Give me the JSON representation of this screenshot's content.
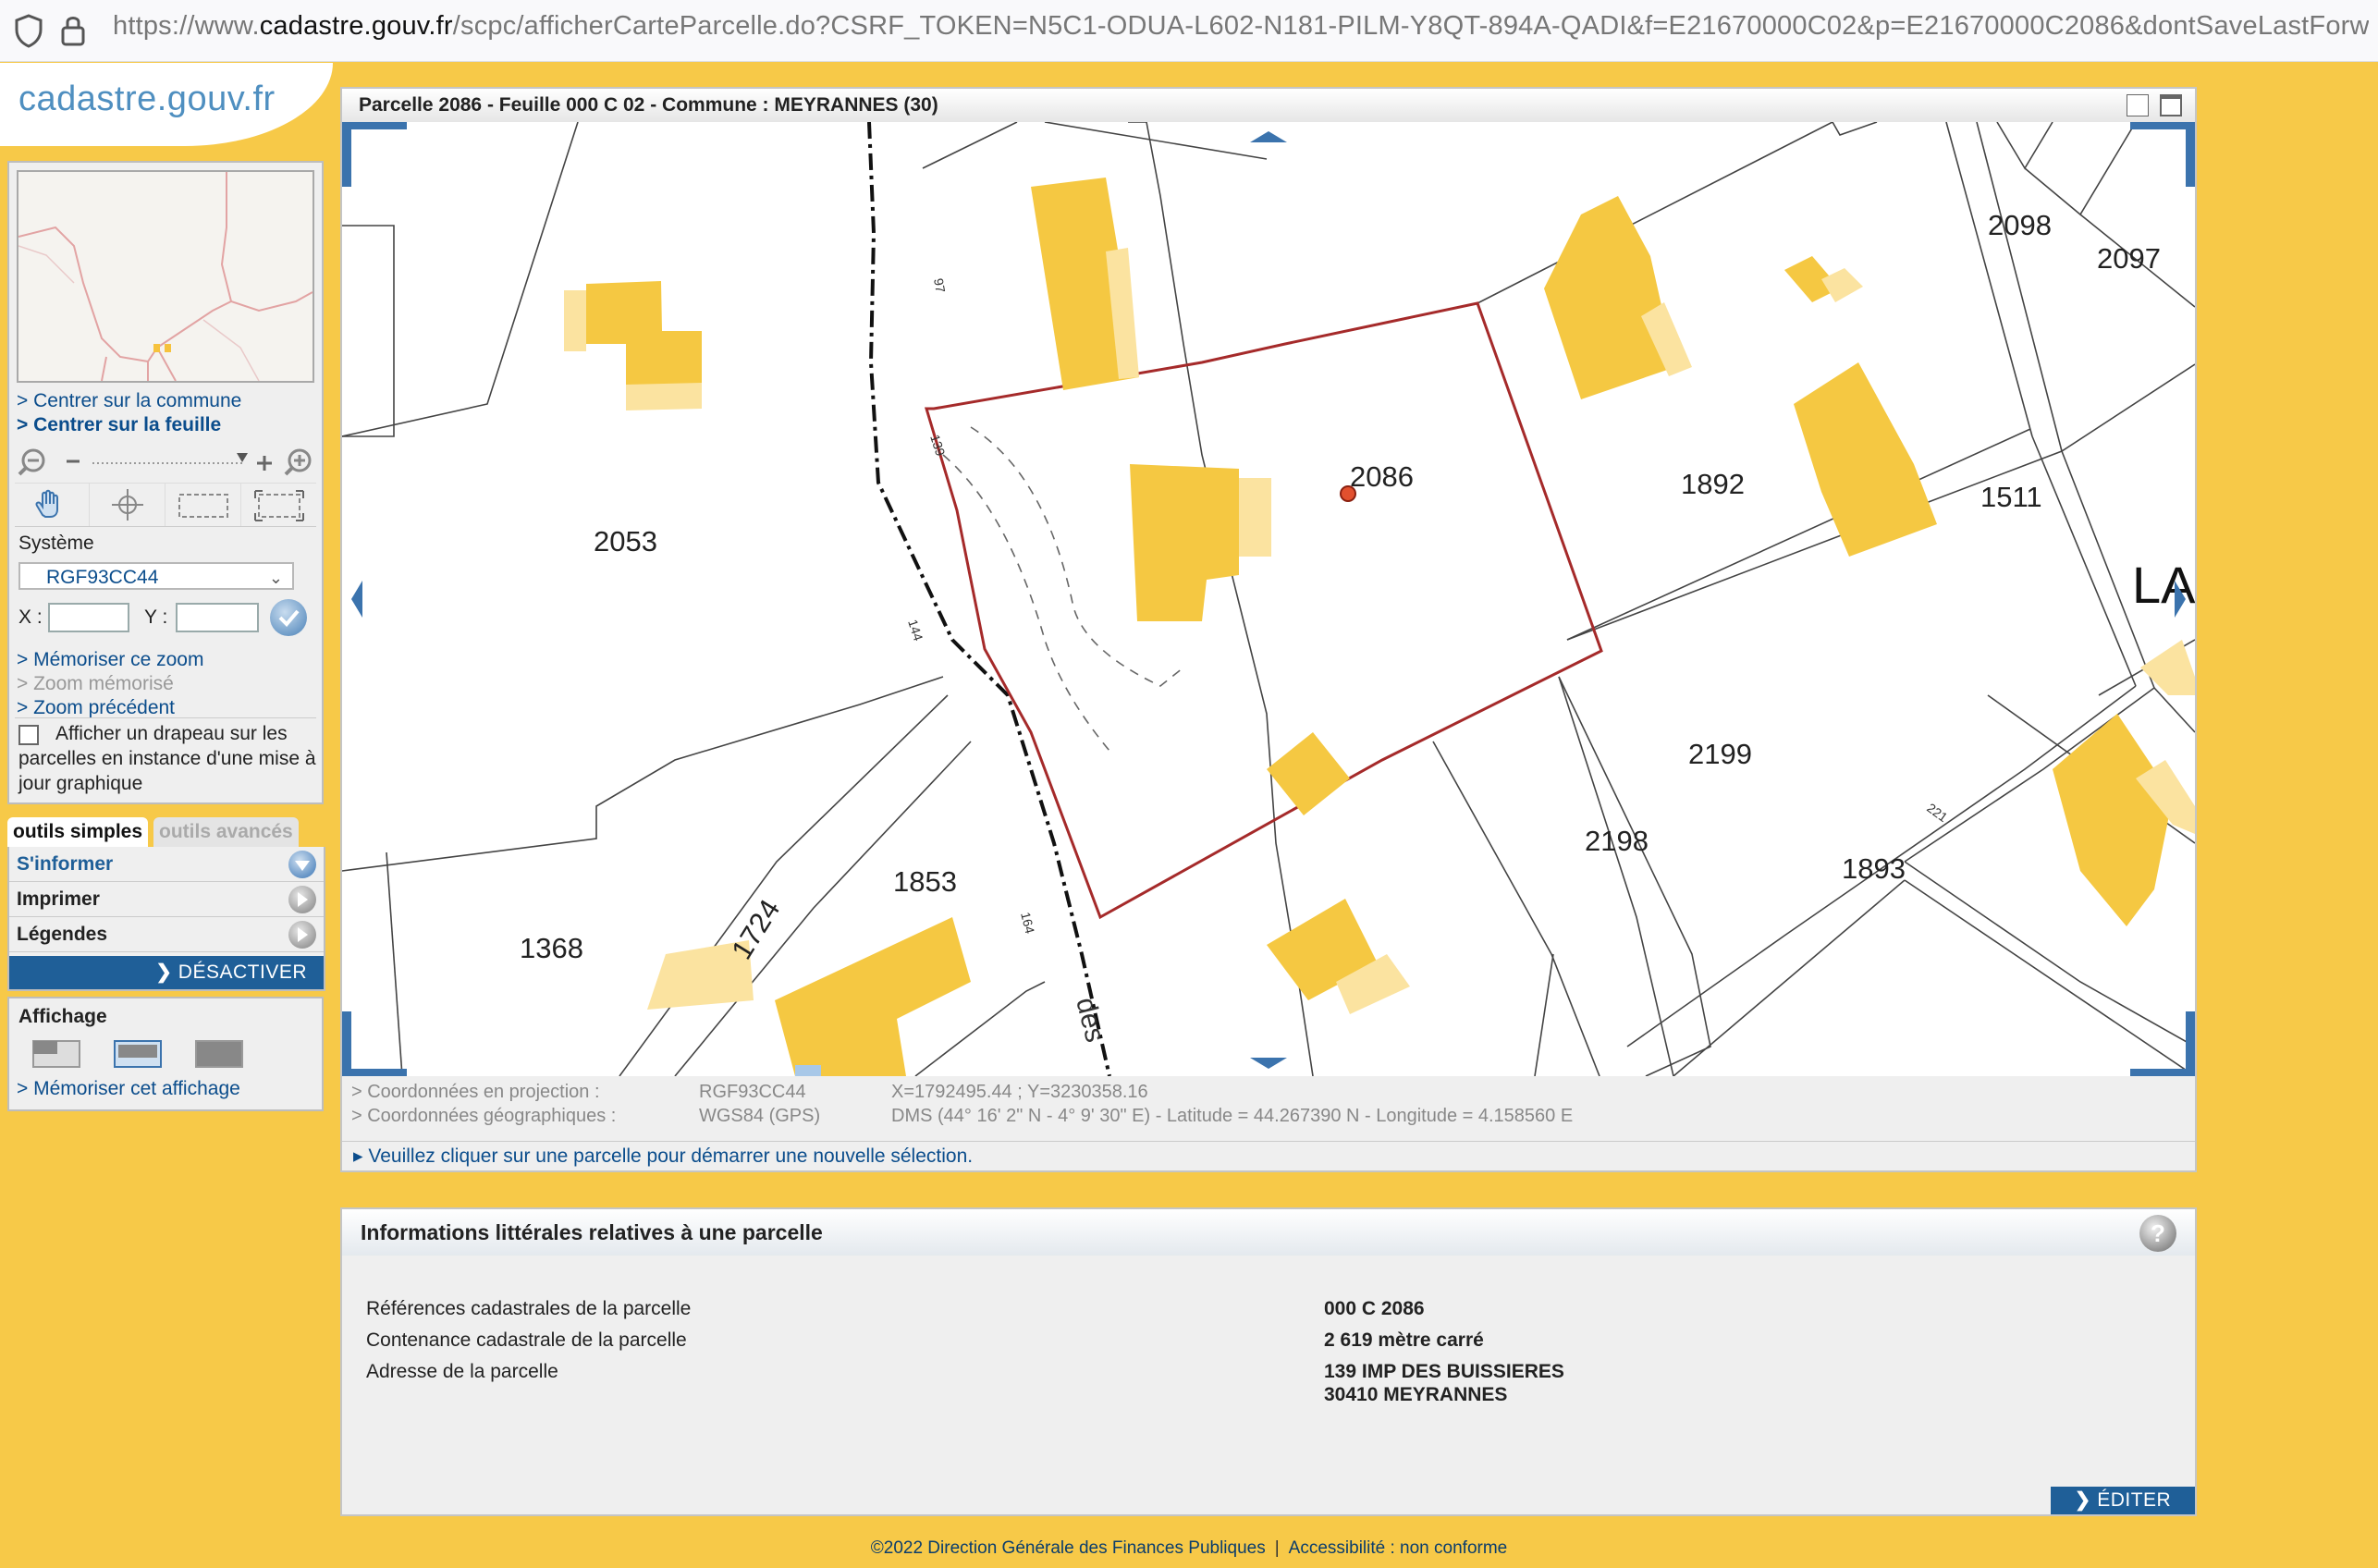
{
  "browser": {
    "url_prefix": "https://www.",
    "url_domain": "cadastre.gouv.fr",
    "url_rest": "/scpc/afficherCarteParcelle.do?CSRF_TOKEN=N5C1-ODUA-L602-N181-PILM-Y8QT-894A-QADI&f=E21670000C02&p=E21670000C2086&dontSaveLastForward&ke"
  },
  "logo": "cadastre.gouv.fr",
  "sidebar": {
    "links_top": [
      "> Centrer sur la commune",
      "> Centrer sur la feuille"
    ],
    "systeme_label": "Système",
    "systeme_value": "RGF93CC44",
    "x_label": "X :",
    "y_label": "Y :",
    "links_zoom": [
      "> Mémoriser ce zoom",
      "> Zoom mémorisé",
      "> Zoom précédent"
    ],
    "flag_text": "Afficher un drapeau sur les parcelles en instance d'une mise à jour graphique",
    "tabs": [
      "outils simples",
      "outils avancés"
    ],
    "tools": [
      "S'informer",
      "Imprimer",
      "Légendes"
    ],
    "desactiver": "DÉSACTIVER",
    "affichage_title": "Affichage",
    "affichage_link": "> Mémoriser cet affichage"
  },
  "map_window": {
    "title": "Parcelle 2086 - Feuille 000 C 02 - Commune : MEYRANNES (30)",
    "parcel_labels": [
      "2053",
      "2086",
      "1892",
      "2098",
      "2097",
      "1511",
      "2199",
      "2198",
      "1893",
      "1853",
      "1724",
      "1368"
    ],
    "road_labels": [
      "97",
      "139",
      "144",
      "164",
      "221",
      "des",
      "LA"
    ],
    "coords": {
      "proj_label": "> Coordonnées en projection :",
      "proj_system": "RGF93CC44",
      "proj_value": "X=1792495.44 ; Y=3230358.16",
      "geo_label": "> Coordonnées géographiques :",
      "geo_system": "WGS84 (GPS)",
      "geo_value": "DMS (44° 16' 2\" N - 4° 9' 30\" E) - Latitude = 44.267390 N - Longitude = 4.158560 E"
    },
    "message": "Veuillez cliquer sur une parcelle pour démarrer une nouvelle sélection."
  },
  "info_window": {
    "title": "Informations littérales relatives à une parcelle",
    "rows": [
      {
        "label": "Références cadastrales de la parcelle",
        "value": "000 C 2086"
      },
      {
        "label": "Contenance cadastrale de la parcelle",
        "value": "2 619 mètre carré"
      },
      {
        "label": "Adresse de la parcelle",
        "value": "139 IMP DES BUISSIERES",
        "value2": "30410 MEYRANNES"
      }
    ],
    "editer": "ÉDITER"
  },
  "footer": {
    "copyright": "©2022 Direction Générale des Finances Publiques",
    "separator": "|",
    "accessibility": "Accessibilité : non conforme"
  },
  "colors": {
    "background": "#f7c948",
    "building": "#f5c842",
    "building_light": "#fbe3a0",
    "parcel_highlight": "#a52a2a",
    "link_blue": "#0b4d8c",
    "button_blue": "#1f5f98"
  }
}
